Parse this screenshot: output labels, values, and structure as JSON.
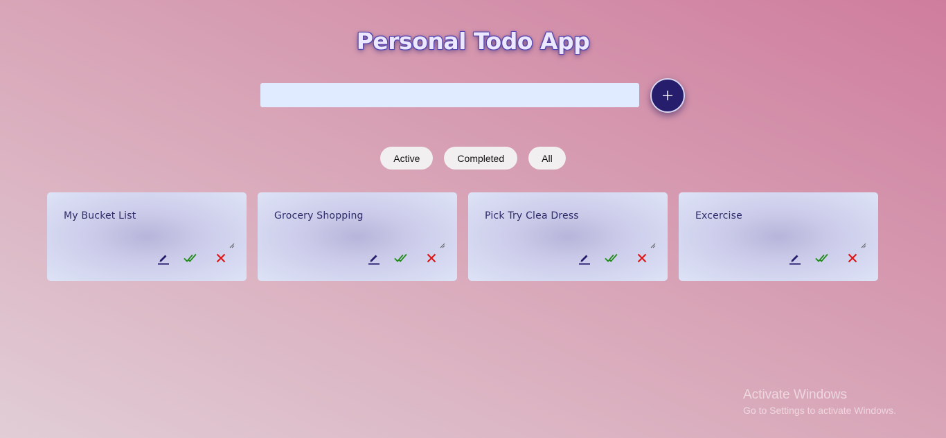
{
  "app": {
    "title": "Personal Todo App"
  },
  "input": {
    "value": "",
    "placeholder": ""
  },
  "add_button": {
    "icon": "plus-icon"
  },
  "filters": [
    {
      "label": "Active"
    },
    {
      "label": "Completed"
    },
    {
      "label": "All"
    }
  ],
  "todos": [
    {
      "title": "My Bucket List"
    },
    {
      "title": "Grocery Shopping"
    },
    {
      "title": "Pick Try Clea Dress"
    },
    {
      "title": "Excercise"
    }
  ],
  "icons": {
    "edit": "pencil-icon",
    "complete": "double-check-icon",
    "delete": "close-icon"
  },
  "colors": {
    "accent": "#261d6d",
    "complete": "#1f8c16",
    "delete": "#e01010",
    "card_text": "#2c2a68"
  },
  "watermark": {
    "title": "Activate Windows",
    "subtitle": "Go to Settings to activate Windows."
  }
}
